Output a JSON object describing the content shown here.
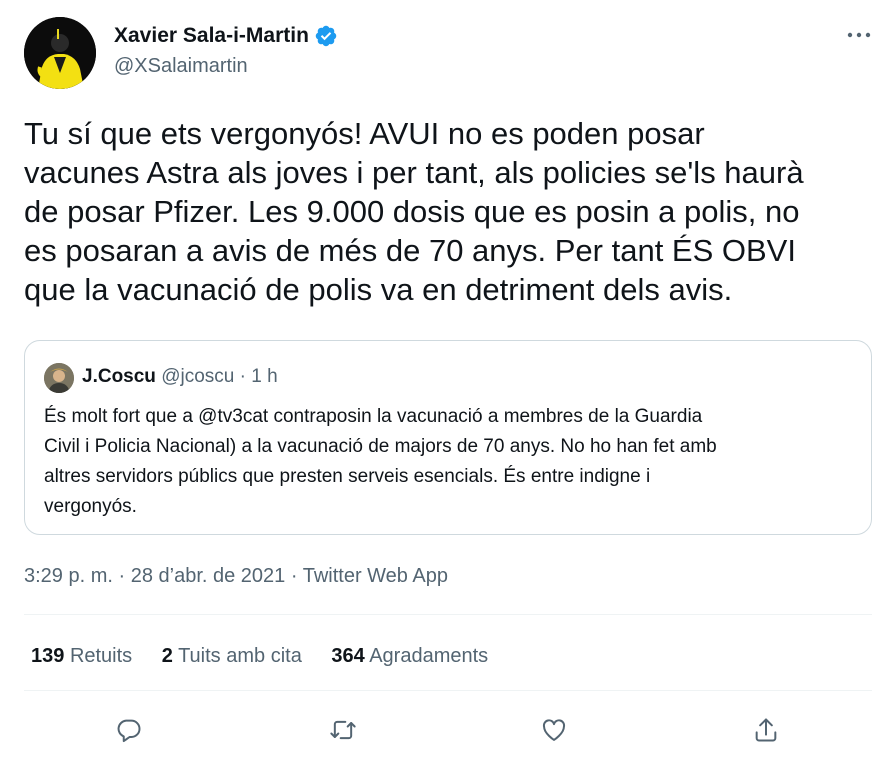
{
  "author": {
    "name": "Xavier Sala-i-Martin",
    "handle": "@XSalaimartin",
    "verified": true
  },
  "tweet": {
    "text": "Tu sí que ets vergonyós! AVUI no es poden posar\nvacunes Astra als joves i per tant, als policies se'ls haurà\nde posar Pfizer. Les 9.000 dosis que es posin a polis, no\nes posaran a avis de més de 70 anys. Per tant ÉS OBVI\nque la vacunació de polis va en detriment dels avis.",
    "timestamp": "3:29 p. m. · 28 d’abr. de 2021 · Twitter Web App"
  },
  "quote": {
    "name": "J.Coscu",
    "handle": "@jcoscu",
    "time": "1 h",
    "text": "És molt fort que a @tv3cat contraposin la vacunació a membres de la Guardia\nCivil i Policia Nacional) a la vacunació de majors de 70 anys. No ho han fet amb\naltres servidors públics que presten serveis esencials. És entre indigne i\nvergonyós."
  },
  "stats": {
    "retweets_count": "139",
    "retweets_label": "Retuits",
    "quotes_count": "2",
    "quotes_label": "Tuits amb cita",
    "likes_count": "364",
    "likes_label": "Agradaments"
  },
  "icons": {
    "more": "more-horizontal-icon",
    "reply": "reply-icon",
    "retweet": "retweet-icon",
    "like": "like-icon",
    "share": "share-icon",
    "verified": "verified-badge-icon"
  },
  "colors": {
    "text": "#0f1419",
    "secondary": "#536471",
    "verified": "#1d9bf0",
    "border": "#cfd9de"
  }
}
